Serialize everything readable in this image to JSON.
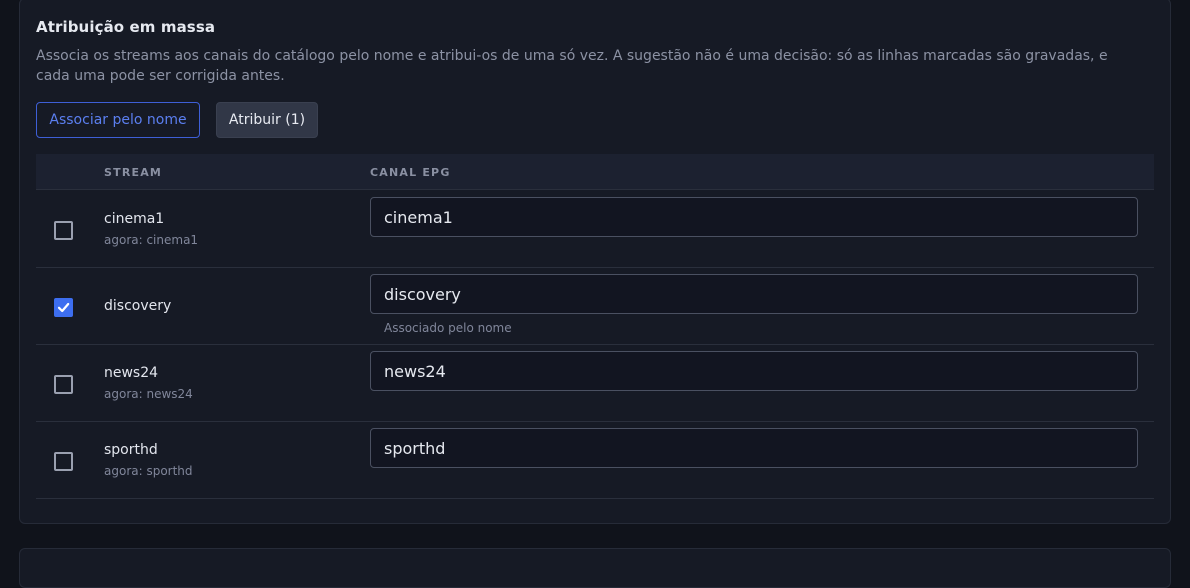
{
  "panel": {
    "title": "Atribuição em massa",
    "description": "Associa os streams aos canais do catálogo pelo nome e atribui-os de uma só vez. A sugestão não é uma decisão: só as linhas marcadas são gravadas, e cada uma pode ser corrigida antes.",
    "associate_button": "Associar pelo nome",
    "assign_button": "Atribuir (1)"
  },
  "table": {
    "headers": {
      "stream": "STREAM",
      "channel": "CANAL EPG"
    },
    "rows": [
      {
        "stream": "cinema1",
        "current": "agora: cinema1",
        "channel": "cinema1",
        "checked": false,
        "hint": ""
      },
      {
        "stream": "discovery",
        "current": "",
        "channel": "discovery",
        "checked": true,
        "hint": "Associado pelo nome"
      },
      {
        "stream": "news24",
        "current": "agora: news24",
        "channel": "news24",
        "checked": false,
        "hint": ""
      },
      {
        "stream": "sporthd",
        "current": "agora: sporthd",
        "channel": "sporthd",
        "checked": false,
        "hint": ""
      }
    ]
  },
  "colors": {
    "accent": "#3d6ef0",
    "background": "#10131b",
    "card": "#161a25"
  }
}
